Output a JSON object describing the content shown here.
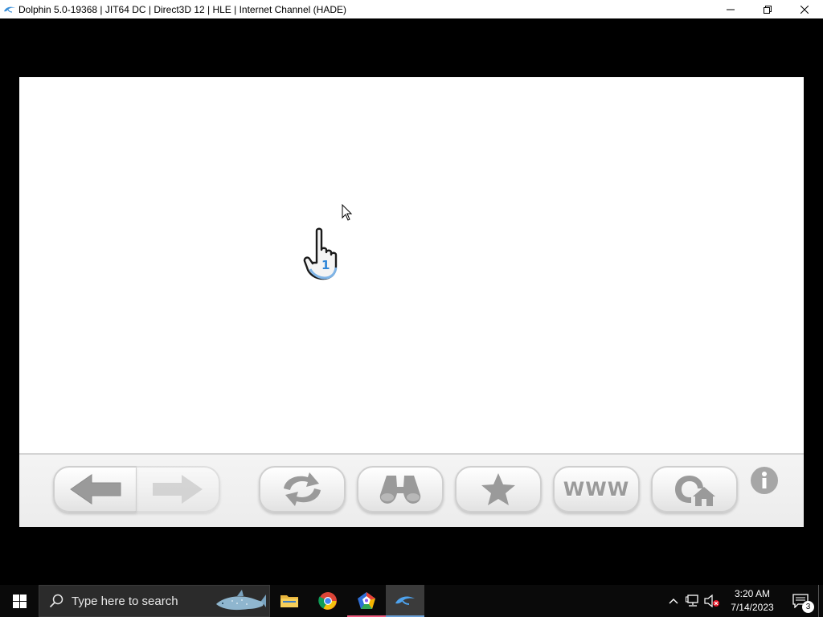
{
  "window": {
    "title": "Dolphin 5.0-19368 | JIT64 DC | Direct3D 12 | HLE | Internet Channel (HADE)",
    "icon": "dolphin-icon",
    "controls": [
      "minimize-icon",
      "restore-icon",
      "close-icon"
    ]
  },
  "internet_channel": {
    "toolbar": {
      "buttons": [
        {
          "name": "back",
          "icon": "arrow-left-icon"
        },
        {
          "name": "forward",
          "icon": "arrow-right-icon",
          "enabled": false
        },
        {
          "name": "reload",
          "icon": "reload-icon"
        },
        {
          "name": "search",
          "icon": "binoculars-icon"
        },
        {
          "name": "favorites",
          "icon": "star-icon"
        },
        {
          "name": "www",
          "label": "WWW"
        },
        {
          "name": "home",
          "icon": "home-icon"
        },
        {
          "name": "info",
          "icon": "info-icon"
        }
      ],
      "www_label": "WWW"
    },
    "pointer": {
      "player": "1",
      "icon": "wii-hand-pointer-icon"
    }
  },
  "taskbar": {
    "search_placeholder": "Type here to search",
    "apps": [
      {
        "name": "file-explorer",
        "icon": "folder-icon"
      },
      {
        "name": "chrome",
        "icon": "chrome-icon"
      },
      {
        "name": "pentagon-app",
        "icon": "pentagon-icon"
      },
      {
        "name": "dolphin",
        "icon": "dolphin-icon",
        "active": true
      }
    ],
    "tray": {
      "time": "3:20 AM",
      "date": "7/14/2023",
      "notifications": "3"
    }
  },
  "colors": {
    "titlebar_bg": "#ffffff",
    "emulator_bg": "#000000",
    "toolbar_icon": "#9a9a9a",
    "taskbar_bg": "#0a0a0a"
  }
}
